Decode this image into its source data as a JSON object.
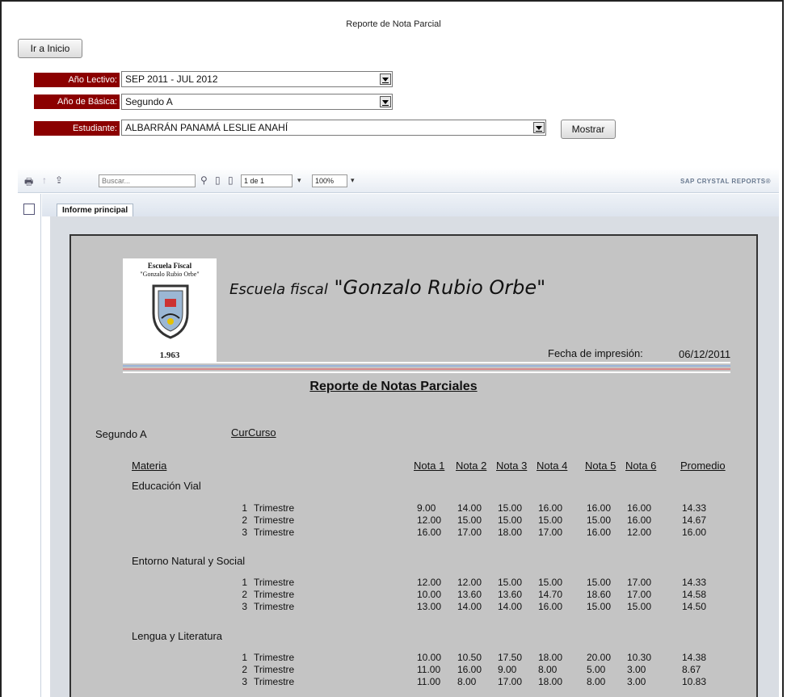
{
  "page": {
    "title": "Reporte de Nota Parcial"
  },
  "nav": {
    "home_button": "Ir a Inicio"
  },
  "filters": {
    "year": {
      "label": "Año Lectivo:",
      "value": "SEP 2011 - JUL 2012"
    },
    "grade": {
      "label": "Año de Básica:",
      "value": "Segundo A"
    },
    "student": {
      "label": "Estudiante:",
      "value": "ALBARRÁN PANAMÁ LESLIE ANAHÍ"
    },
    "show_button": "Mostrar"
  },
  "viewer_toolbar": {
    "search_placeholder": "Buscar...",
    "page_value": "1 de 1",
    "zoom_value": "100%",
    "brand": "SAP CRYSTAL REPORTS®"
  },
  "tabs": {
    "main": "Informe principal"
  },
  "report": {
    "logo": {
      "line1": "Escuela Fiscal",
      "line2": "\"Gonzalo Rubio Orbe\"",
      "year": "1.963"
    },
    "school_prefix": "Escuela fiscal",
    "school_name": "\"Gonzalo Rubio Orbe\"",
    "print_label": "Fecha de impresión:",
    "print_date": "06/12/2011",
    "title": "Reporte de Notas Parciales",
    "course": "Segundo A",
    "course_field": "CurCurso",
    "headers": {
      "subject": "Materia",
      "n1": "Nota 1",
      "n2": "Nota 2",
      "n3": "Nota 3",
      "n4": "Nota 4",
      "n5": "Nota 5",
      "n6": "Nota 6",
      "avg": "Promedio"
    },
    "subjects": [
      {
        "name": "Educación Vial",
        "rows": [
          {
            "num": "1",
            "term": "Trimestre",
            "n1": "9.00",
            "n2": "14.00",
            "n3": "15.00",
            "n4": "16.00",
            "n5": "16.00",
            "n6": "16.00",
            "avg": "14.33"
          },
          {
            "num": "2",
            "term": "Trimestre",
            "n1": "12.00",
            "n2": "15.00",
            "n3": "15.00",
            "n4": "15.00",
            "n5": "15.00",
            "n6": "16.00",
            "avg": "14.67"
          },
          {
            "num": "3",
            "term": "Trimestre",
            "n1": "16.00",
            "n2": "17.00",
            "n3": "18.00",
            "n4": "17.00",
            "n5": "16.00",
            "n6": "12.00",
            "avg": "16.00"
          }
        ]
      },
      {
        "name": "Entorno Natural y Social",
        "rows": [
          {
            "num": "1",
            "term": "Trimestre",
            "n1": "12.00",
            "n2": "12.00",
            "n3": "15.00",
            "n4": "15.00",
            "n5": "15.00",
            "n6": "17.00",
            "avg": "14.33"
          },
          {
            "num": "2",
            "term": "Trimestre",
            "n1": "10.00",
            "n2": "13.60",
            "n3": "13.60",
            "n4": "14.70",
            "n5": "18.60",
            "n6": "17.00",
            "avg": "14.58"
          },
          {
            "num": "3",
            "term": "Trimestre",
            "n1": "13.00",
            "n2": "14.00",
            "n3": "14.00",
            "n4": "16.00",
            "n5": "15.00",
            "n6": "15.00",
            "avg": "14.50"
          }
        ]
      },
      {
        "name": "Lengua y Literatura",
        "rows": [
          {
            "num": "1",
            "term": "Trimestre",
            "n1": "10.00",
            "n2": "10.50",
            "n3": "17.50",
            "n4": "18.00",
            "n5": "20.00",
            "n6": "10.30",
            "avg": "14.38"
          },
          {
            "num": "2",
            "term": "Trimestre",
            "n1": "11.00",
            "n2": "16.00",
            "n3": "9.00",
            "n4": "8.00",
            "n5": "5.00",
            "n6": "3.00",
            "avg": "8.67"
          },
          {
            "num": "3",
            "term": "Trimestre",
            "n1": "11.00",
            "n2": "8.00",
            "n3": "17.00",
            "n4": "18.00",
            "n5": "8.00",
            "n6": "3.00",
            "avg": "10.83"
          }
        ]
      }
    ]
  }
}
